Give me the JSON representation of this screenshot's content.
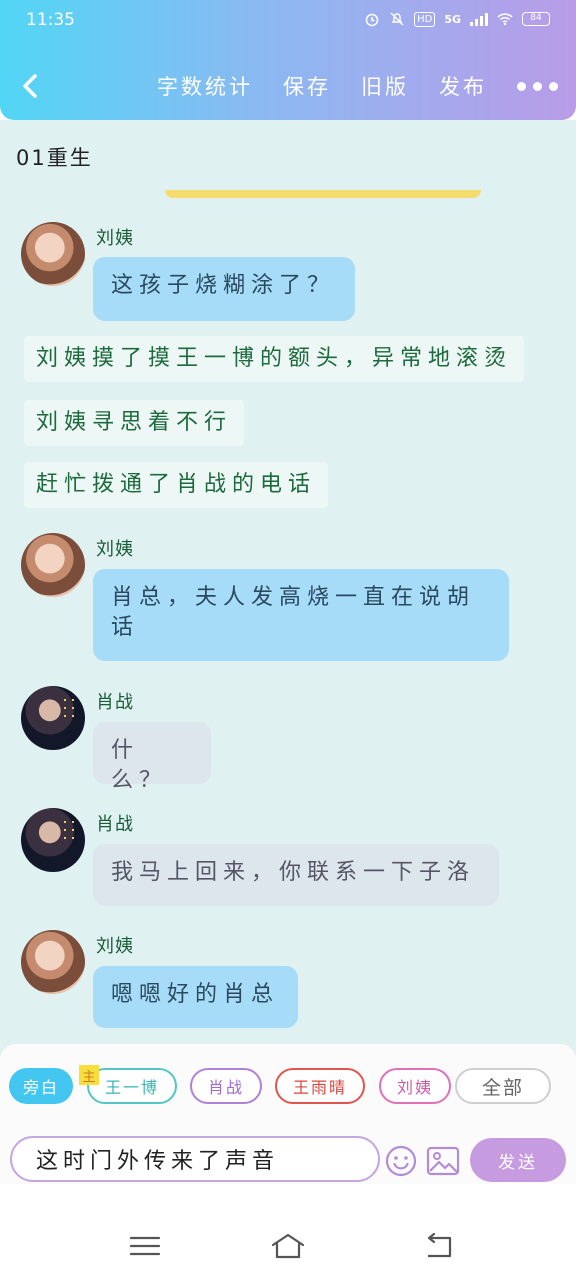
{
  "status_bar": {
    "time": "11:35",
    "network": "5G",
    "battery": "84"
  },
  "header": {
    "actions": [
      "字数统计",
      "保存",
      "旧版",
      "发布"
    ]
  },
  "chapter": {
    "title": "01重生"
  },
  "messages": [
    {
      "type": "dialog",
      "speaker": "刘姨",
      "text": "这孩子烧糊涂了？"
    },
    {
      "type": "narration",
      "text": "刘姨摸了摸王一博的额头，异常地滚烫"
    },
    {
      "type": "narration",
      "text": "刘姨寻思着不行"
    },
    {
      "type": "narration",
      "text": "赶忙拨通了肖战的电话"
    },
    {
      "type": "dialog",
      "speaker": "刘姨",
      "text": "肖总，夫人发高烧一直在说胡话"
    },
    {
      "type": "dialog",
      "speaker": "肖战",
      "text": "什么？"
    },
    {
      "type": "dialog",
      "speaker": "肖战",
      "text": "我马上回来，你联系一下子洛"
    },
    {
      "type": "dialog",
      "speaker": "刘姨",
      "text": "嗯嗯好的肖总"
    }
  ],
  "roles": {
    "narration": "旁白",
    "main_tag": "主",
    "wang_yibo": "王一博",
    "xiao_zhan": "肖战",
    "wang_yuqing": "王雨晴",
    "liu_yi": "刘姨",
    "all": "全部"
  },
  "composer": {
    "input_value": "这时门外传来了声音",
    "send_label": "发送"
  },
  "colors": {
    "header_gradient_start": "#52d6f5",
    "header_gradient_end": "#b99ce8",
    "chat_background": "#e0f1f1",
    "bubble_blue": "#a6dcf7",
    "bubble_gray": "#dde6ec",
    "narration_text": "#1d6a3c",
    "send_button": "#c79bdf"
  }
}
